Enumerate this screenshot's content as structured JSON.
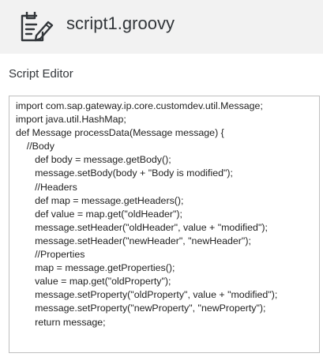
{
  "header": {
    "file_icon": "script-file-pen-icon",
    "file_name": "script1.groovy"
  },
  "editor": {
    "label": "Script Editor",
    "lines": [
      "import com.sap.gateway.ip.core.customdev.util.Message;",
      "import java.util.HashMap;",
      "def Message processData(Message message) {",
      "    //Body",
      "       def body = message.getBody();",
      "       message.setBody(body + \"Body is modified\");",
      "       //Headers",
      "       def map = message.getHeaders();",
      "       def value = map.get(\"oldHeader\");",
      "       message.setHeader(\"oldHeader\", value + \"modified\");",
      "       message.setHeader(\"newHeader\", \"newHeader\");",
      "       //Properties",
      "       map = message.getProperties();",
      "       value = map.get(\"oldProperty\");",
      "       message.setProperty(\"oldProperty\", value + \"modified\");",
      "       message.setProperty(\"newProperty\", \"newProperty\");",
      "       return message;"
    ]
  }
}
